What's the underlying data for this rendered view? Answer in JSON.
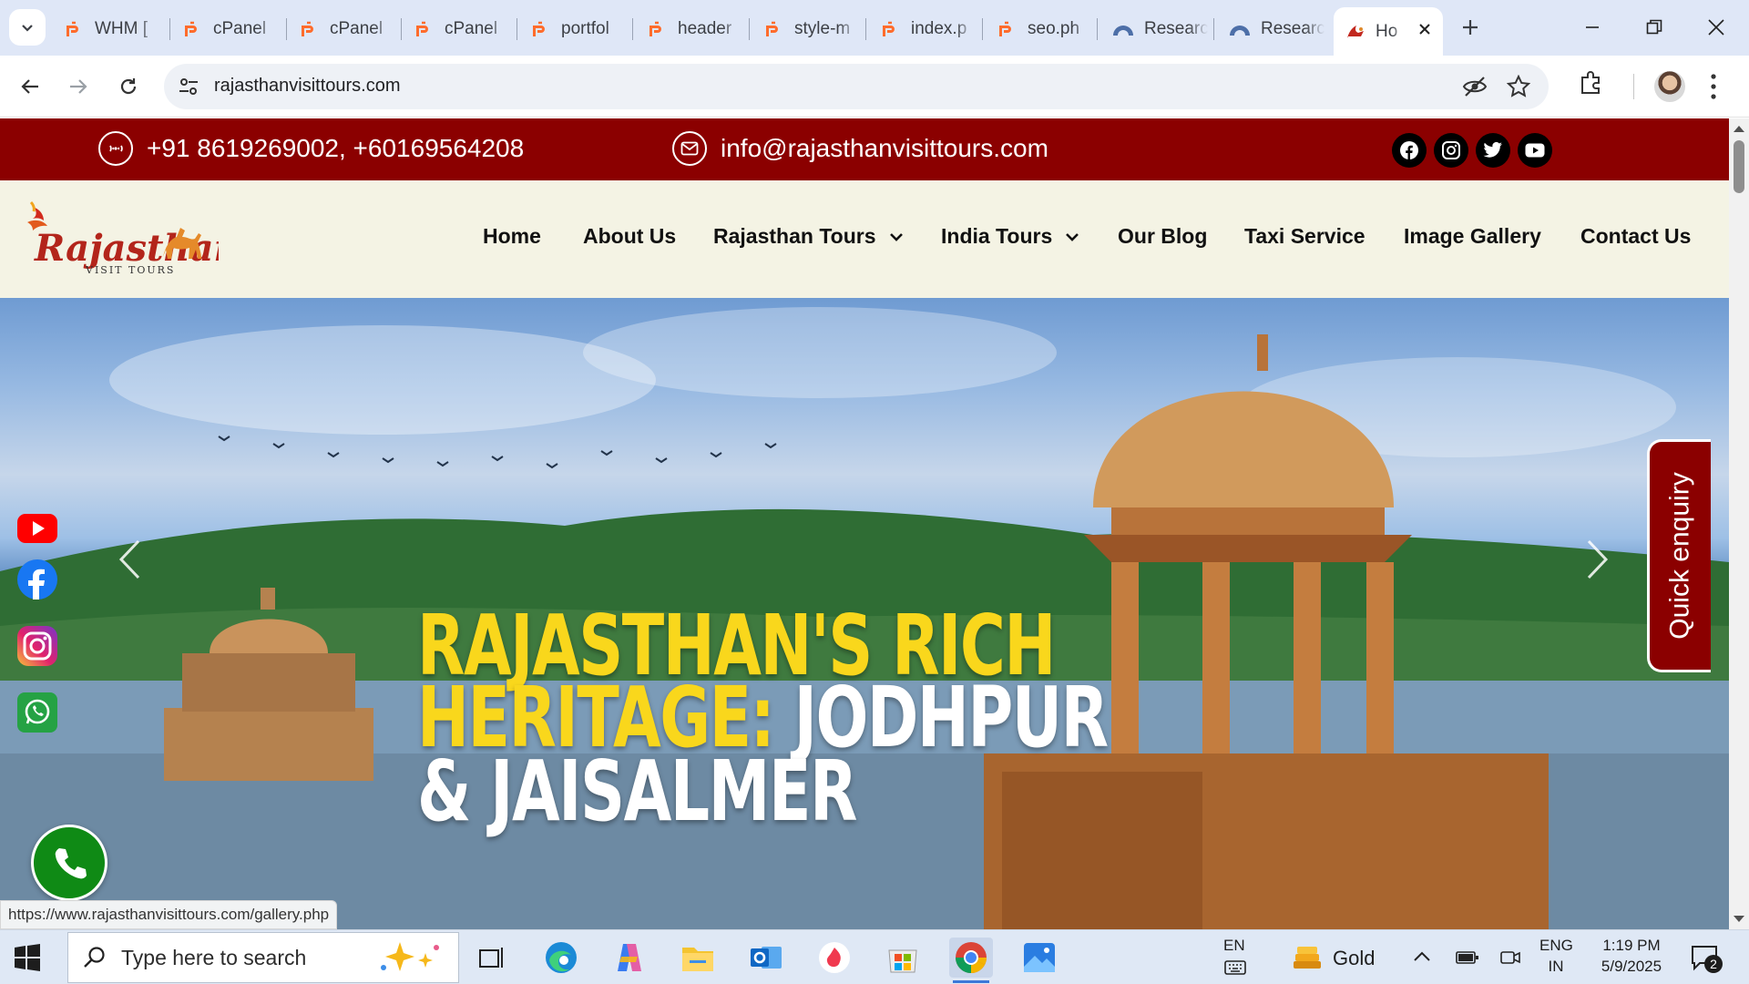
{
  "browser": {
    "tabs": [
      {
        "title": "WHM [",
        "favicon": "cpanel-icon"
      },
      {
        "title": "cPanel",
        "favicon": "cpanel-icon"
      },
      {
        "title": "cPanel",
        "favicon": "cpanel-icon"
      },
      {
        "title": "cPanel",
        "favicon": "cpanel-icon"
      },
      {
        "title": "portfol",
        "favicon": "cpanel-icon"
      },
      {
        "title": "header",
        "favicon": "cpanel-icon"
      },
      {
        "title": "style-m",
        "favicon": "cpanel-icon"
      },
      {
        "title": "index.p",
        "favicon": "cpanel-icon"
      },
      {
        "title": "seo.ph",
        "favicon": "cpanel-icon"
      },
      {
        "title": "Researc",
        "favicon": "research-icon"
      },
      {
        "title": "Researc",
        "favicon": "research-icon"
      }
    ],
    "active_tab": {
      "title": "Ho",
      "favicon": "rajasthan-logo-icon"
    },
    "url": "rajasthanvisittours.com",
    "status_url": "https://www.rajasthanvisittours.com/gallery.php"
  },
  "site": {
    "topbar": {
      "phone": "+91 8619269002, +60169564208",
      "email": "info@rajasthanvisittours.com",
      "social": [
        "facebook-icon",
        "instagram-icon",
        "twitter-icon",
        "youtube-icon"
      ]
    },
    "logo": {
      "name": "Rajasthan",
      "tagline": "VISIT TOURS"
    },
    "menu": [
      {
        "label": "Home",
        "dropdown": false
      },
      {
        "label": "About Us",
        "dropdown": false
      },
      {
        "label": "Rajasthan Tours",
        "dropdown": true
      },
      {
        "label": "India Tours",
        "dropdown": true
      },
      {
        "label": "Our Blog",
        "dropdown": false
      },
      {
        "label": "Taxi Service",
        "dropdown": false
      },
      {
        "label": "Image Gallery",
        "dropdown": false
      },
      {
        "label": "Contact Us",
        "dropdown": false
      }
    ],
    "hero": {
      "line1": "RAJASTHAN'S RICH",
      "line2_yellow": "HERITAGE:",
      "line2_white": " JODHPUR",
      "line3": "& JAISALMER"
    },
    "floating_social": [
      "youtube-icon",
      "facebook-icon",
      "instagram-icon",
      "whatsapp-icon"
    ],
    "quick_enquiry": "Quick enquiry"
  },
  "taskbar": {
    "search_placeholder": "Type here to search",
    "apps": [
      "task-view-icon",
      "edge-icon",
      "copilot-icon",
      "file-explorer-icon",
      "outlook-icon",
      "app-icon",
      "store-icon",
      "chrome-icon",
      "photos-icon"
    ],
    "lang_top": "EN",
    "weather": "Gold",
    "lang1": "ENG",
    "lang2": "IN",
    "time": "1:19 PM",
    "date": "5/9/2025",
    "notifications": "2"
  },
  "colors": {
    "brand_red": "#8b0000",
    "nav_bg": "#f4f3e4",
    "hero_yellow": "#f9d71c",
    "call_green": "#0f8a15"
  }
}
